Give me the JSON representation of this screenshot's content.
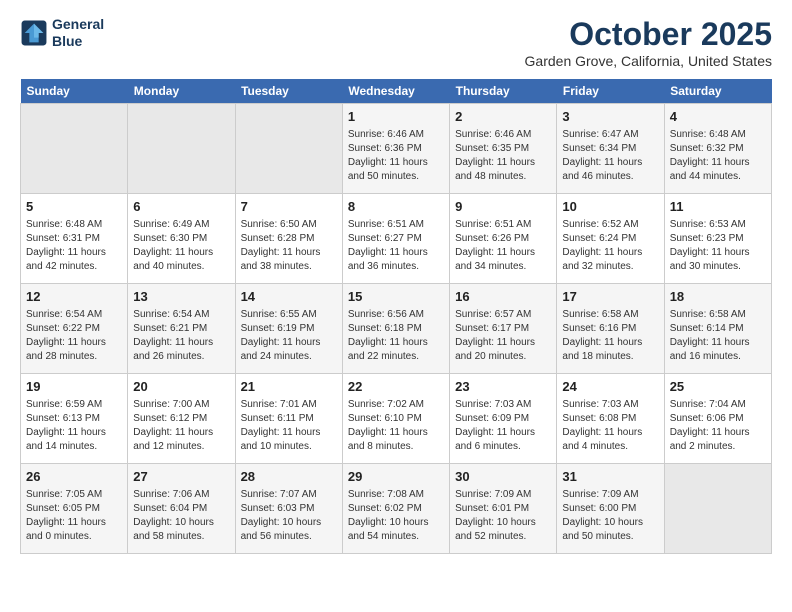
{
  "logo": {
    "line1": "General",
    "line2": "Blue"
  },
  "title": "October 2025",
  "subtitle": "Garden Grove, California, United States",
  "days_header": [
    "Sunday",
    "Monday",
    "Tuesday",
    "Wednesday",
    "Thursday",
    "Friday",
    "Saturday"
  ],
  "weeks": [
    [
      {
        "num": "",
        "info": ""
      },
      {
        "num": "",
        "info": ""
      },
      {
        "num": "",
        "info": ""
      },
      {
        "num": "1",
        "info": "Sunrise: 6:46 AM\nSunset: 6:36 PM\nDaylight: 11 hours\nand 50 minutes."
      },
      {
        "num": "2",
        "info": "Sunrise: 6:46 AM\nSunset: 6:35 PM\nDaylight: 11 hours\nand 48 minutes."
      },
      {
        "num": "3",
        "info": "Sunrise: 6:47 AM\nSunset: 6:34 PM\nDaylight: 11 hours\nand 46 minutes."
      },
      {
        "num": "4",
        "info": "Sunrise: 6:48 AM\nSunset: 6:32 PM\nDaylight: 11 hours\nand 44 minutes."
      }
    ],
    [
      {
        "num": "5",
        "info": "Sunrise: 6:48 AM\nSunset: 6:31 PM\nDaylight: 11 hours\nand 42 minutes."
      },
      {
        "num": "6",
        "info": "Sunrise: 6:49 AM\nSunset: 6:30 PM\nDaylight: 11 hours\nand 40 minutes."
      },
      {
        "num": "7",
        "info": "Sunrise: 6:50 AM\nSunset: 6:28 PM\nDaylight: 11 hours\nand 38 minutes."
      },
      {
        "num": "8",
        "info": "Sunrise: 6:51 AM\nSunset: 6:27 PM\nDaylight: 11 hours\nand 36 minutes."
      },
      {
        "num": "9",
        "info": "Sunrise: 6:51 AM\nSunset: 6:26 PM\nDaylight: 11 hours\nand 34 minutes."
      },
      {
        "num": "10",
        "info": "Sunrise: 6:52 AM\nSunset: 6:24 PM\nDaylight: 11 hours\nand 32 minutes."
      },
      {
        "num": "11",
        "info": "Sunrise: 6:53 AM\nSunset: 6:23 PM\nDaylight: 11 hours\nand 30 minutes."
      }
    ],
    [
      {
        "num": "12",
        "info": "Sunrise: 6:54 AM\nSunset: 6:22 PM\nDaylight: 11 hours\nand 28 minutes."
      },
      {
        "num": "13",
        "info": "Sunrise: 6:54 AM\nSunset: 6:21 PM\nDaylight: 11 hours\nand 26 minutes."
      },
      {
        "num": "14",
        "info": "Sunrise: 6:55 AM\nSunset: 6:19 PM\nDaylight: 11 hours\nand 24 minutes."
      },
      {
        "num": "15",
        "info": "Sunrise: 6:56 AM\nSunset: 6:18 PM\nDaylight: 11 hours\nand 22 minutes."
      },
      {
        "num": "16",
        "info": "Sunrise: 6:57 AM\nSunset: 6:17 PM\nDaylight: 11 hours\nand 20 minutes."
      },
      {
        "num": "17",
        "info": "Sunrise: 6:58 AM\nSunset: 6:16 PM\nDaylight: 11 hours\nand 18 minutes."
      },
      {
        "num": "18",
        "info": "Sunrise: 6:58 AM\nSunset: 6:14 PM\nDaylight: 11 hours\nand 16 minutes."
      }
    ],
    [
      {
        "num": "19",
        "info": "Sunrise: 6:59 AM\nSunset: 6:13 PM\nDaylight: 11 hours\nand 14 minutes."
      },
      {
        "num": "20",
        "info": "Sunrise: 7:00 AM\nSunset: 6:12 PM\nDaylight: 11 hours\nand 12 minutes."
      },
      {
        "num": "21",
        "info": "Sunrise: 7:01 AM\nSunset: 6:11 PM\nDaylight: 11 hours\nand 10 minutes."
      },
      {
        "num": "22",
        "info": "Sunrise: 7:02 AM\nSunset: 6:10 PM\nDaylight: 11 hours\nand 8 minutes."
      },
      {
        "num": "23",
        "info": "Sunrise: 7:03 AM\nSunset: 6:09 PM\nDaylight: 11 hours\nand 6 minutes."
      },
      {
        "num": "24",
        "info": "Sunrise: 7:03 AM\nSunset: 6:08 PM\nDaylight: 11 hours\nand 4 minutes."
      },
      {
        "num": "25",
        "info": "Sunrise: 7:04 AM\nSunset: 6:06 PM\nDaylight: 11 hours\nand 2 minutes."
      }
    ],
    [
      {
        "num": "26",
        "info": "Sunrise: 7:05 AM\nSunset: 6:05 PM\nDaylight: 11 hours\nand 0 minutes."
      },
      {
        "num": "27",
        "info": "Sunrise: 7:06 AM\nSunset: 6:04 PM\nDaylight: 10 hours\nand 58 minutes."
      },
      {
        "num": "28",
        "info": "Sunrise: 7:07 AM\nSunset: 6:03 PM\nDaylight: 10 hours\nand 56 minutes."
      },
      {
        "num": "29",
        "info": "Sunrise: 7:08 AM\nSunset: 6:02 PM\nDaylight: 10 hours\nand 54 minutes."
      },
      {
        "num": "30",
        "info": "Sunrise: 7:09 AM\nSunset: 6:01 PM\nDaylight: 10 hours\nand 52 minutes."
      },
      {
        "num": "31",
        "info": "Sunrise: 7:09 AM\nSunset: 6:00 PM\nDaylight: 10 hours\nand 50 minutes."
      },
      {
        "num": "",
        "info": ""
      }
    ]
  ]
}
